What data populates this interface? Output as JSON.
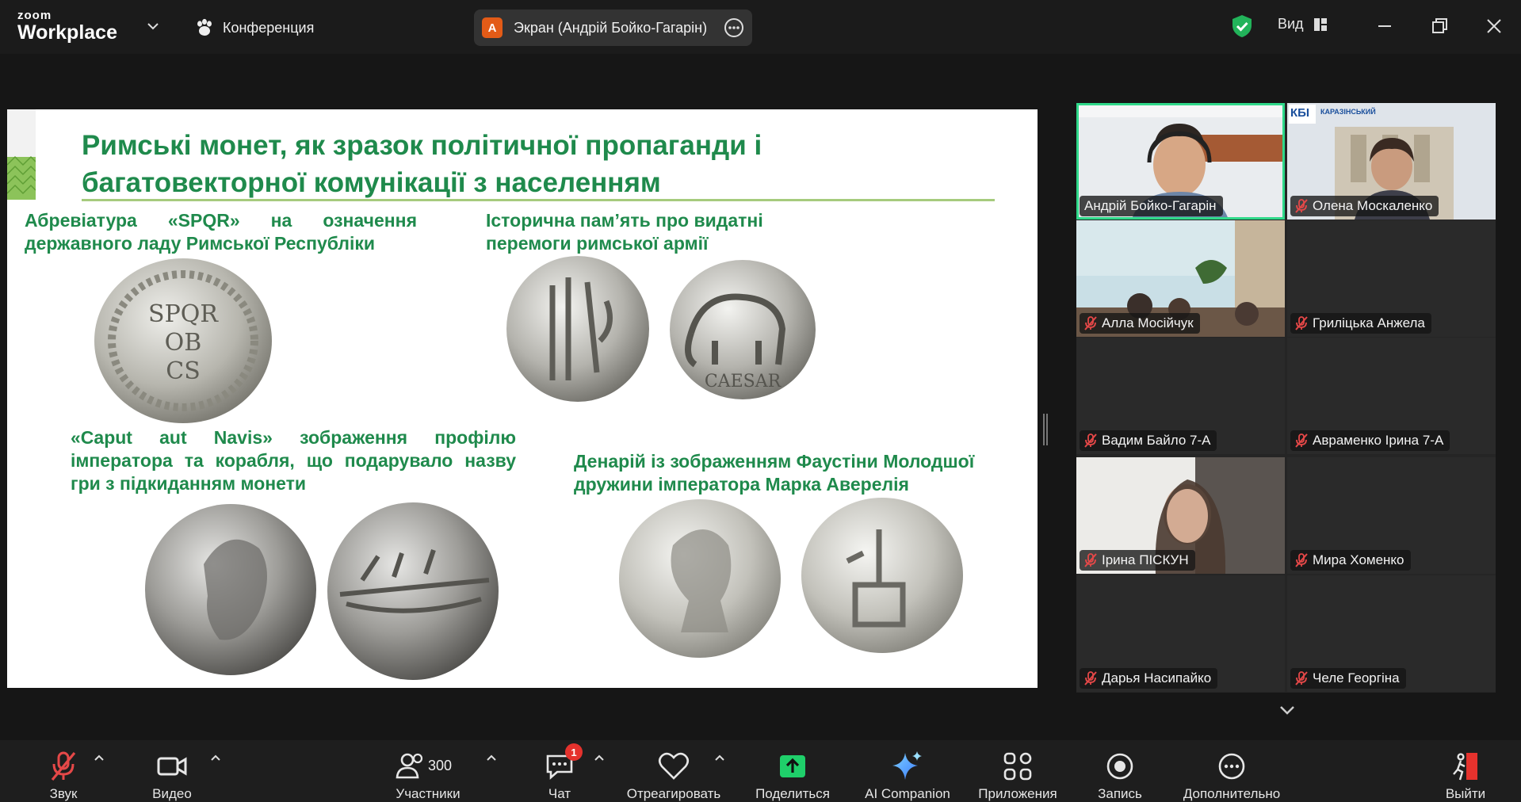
{
  "app": {
    "brand_small": "zoom",
    "brand_big": "Workplace"
  },
  "header": {
    "conference_label": "Конференция",
    "screen_share": {
      "avatar_letter": "A",
      "label": "Экран (Андрій Бойко-Гагарін)"
    },
    "view_label": "Вид"
  },
  "slide": {
    "title_line1": "Римські монет, як зразок політичної пропаганди і",
    "title_line2": "багатовекторної комунікації з населенням",
    "captions": {
      "spqr_line1": "Абревіатура «SPQR» на означення",
      "spqr_line2": "державного ладу Римської Республіки",
      "victories_line1": "Історична пам’ять про видатні",
      "victories_line2": "перемоги римської армії",
      "caput_line1": "«Caput aut Navis» зображення профілю",
      "caput_line2": "імператора та корабля, що подарувало назву",
      "caput_line3": "гри з підкиданням монети",
      "faustina_line1": "Денарій із зображенням Фаустіни Молодшої",
      "faustina_line2": "дружини імператора  Марка Аверелія"
    },
    "coin_texts": {
      "spqr_1": "SPQR",
      "spqr_2": "OB",
      "spqr_3": "CS",
      "caesar": "CAESAR"
    }
  },
  "participants": [
    {
      "name": "Андрій Бойко-Гагарін",
      "muted": false,
      "video": true,
      "active": true
    },
    {
      "name": "Олена Москаленко",
      "muted": true,
      "video": true,
      "active": false,
      "logo_text": "КБІ",
      "logo_sub": "КАРАЗІНСЬКИЙ"
    },
    {
      "name": "Алла Мосійчук",
      "muted": true,
      "video": true,
      "active": false
    },
    {
      "name": "Гриліцька Анжела",
      "muted": true,
      "video": false,
      "active": false
    },
    {
      "name": "Вадим Байло 7-А",
      "muted": true,
      "video": false,
      "active": false
    },
    {
      "name": "Авраменко Ірина 7-А",
      "muted": true,
      "video": false,
      "active": false
    },
    {
      "name": "Ірина ПІСКУН",
      "muted": true,
      "video": true,
      "active": false
    },
    {
      "name": "Мира Хоменко",
      "muted": true,
      "video": false,
      "active": false
    },
    {
      "name": "Дарья Насипайко",
      "muted": true,
      "video": false,
      "active": false
    },
    {
      "name": "Челе Георгіна",
      "muted": true,
      "video": false,
      "active": false
    }
  ],
  "toolbar": {
    "audio": "Звук",
    "video": "Видео",
    "participants": "Участники",
    "participants_count": "300",
    "chat": "Чат",
    "chat_badge": "1",
    "react": "Отреагировать",
    "share": "Поделиться",
    "ai": "AI Companion",
    "apps": "Приложения",
    "record": "Запись",
    "more": "Дополнительно",
    "leave": "Выйти"
  },
  "colors": {
    "accent_green": "#2fd98a",
    "slide_title": "#1f8a4c",
    "share_green": "#1fcf6a",
    "badge_red": "#e5322d",
    "muted_red": "#e54848",
    "avatar_orange": "#e35b17"
  }
}
